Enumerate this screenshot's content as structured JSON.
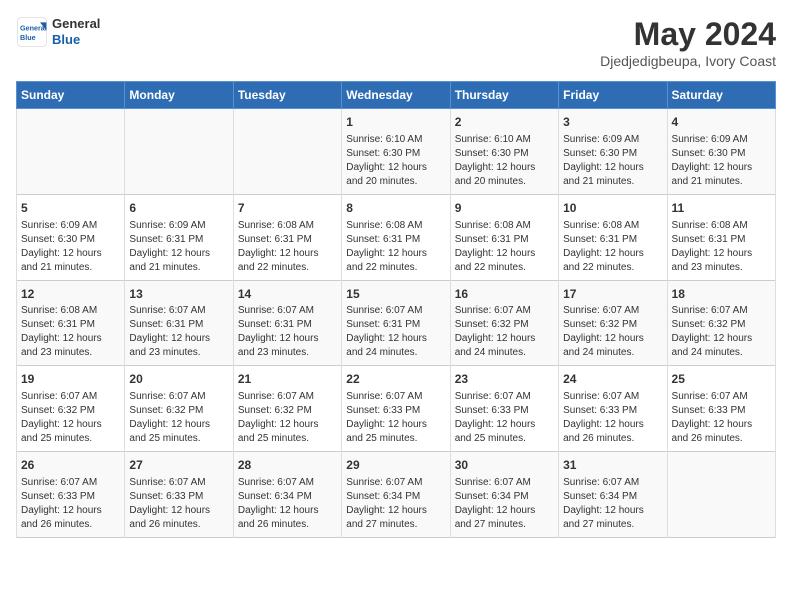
{
  "logo": {
    "line1": "General",
    "line2": "Blue"
  },
  "title": "May 2024",
  "location": "Djedjedigbeupa, Ivory Coast",
  "weekdays": [
    "Sunday",
    "Monday",
    "Tuesday",
    "Wednesday",
    "Thursday",
    "Friday",
    "Saturday"
  ],
  "weeks": [
    [
      {
        "day": "",
        "info": ""
      },
      {
        "day": "",
        "info": ""
      },
      {
        "day": "",
        "info": ""
      },
      {
        "day": "1",
        "info": "Sunrise: 6:10 AM\nSunset: 6:30 PM\nDaylight: 12 hours\nand 20 minutes."
      },
      {
        "day": "2",
        "info": "Sunrise: 6:10 AM\nSunset: 6:30 PM\nDaylight: 12 hours\nand 20 minutes."
      },
      {
        "day": "3",
        "info": "Sunrise: 6:09 AM\nSunset: 6:30 PM\nDaylight: 12 hours\nand 21 minutes."
      },
      {
        "day": "4",
        "info": "Sunrise: 6:09 AM\nSunset: 6:30 PM\nDaylight: 12 hours\nand 21 minutes."
      }
    ],
    [
      {
        "day": "5",
        "info": "Sunrise: 6:09 AM\nSunset: 6:30 PM\nDaylight: 12 hours\nand 21 minutes."
      },
      {
        "day": "6",
        "info": "Sunrise: 6:09 AM\nSunset: 6:31 PM\nDaylight: 12 hours\nand 21 minutes."
      },
      {
        "day": "7",
        "info": "Sunrise: 6:08 AM\nSunset: 6:31 PM\nDaylight: 12 hours\nand 22 minutes."
      },
      {
        "day": "8",
        "info": "Sunrise: 6:08 AM\nSunset: 6:31 PM\nDaylight: 12 hours\nand 22 minutes."
      },
      {
        "day": "9",
        "info": "Sunrise: 6:08 AM\nSunset: 6:31 PM\nDaylight: 12 hours\nand 22 minutes."
      },
      {
        "day": "10",
        "info": "Sunrise: 6:08 AM\nSunset: 6:31 PM\nDaylight: 12 hours\nand 22 minutes."
      },
      {
        "day": "11",
        "info": "Sunrise: 6:08 AM\nSunset: 6:31 PM\nDaylight: 12 hours\nand 23 minutes."
      }
    ],
    [
      {
        "day": "12",
        "info": "Sunrise: 6:08 AM\nSunset: 6:31 PM\nDaylight: 12 hours\nand 23 minutes."
      },
      {
        "day": "13",
        "info": "Sunrise: 6:07 AM\nSunset: 6:31 PM\nDaylight: 12 hours\nand 23 minutes."
      },
      {
        "day": "14",
        "info": "Sunrise: 6:07 AM\nSunset: 6:31 PM\nDaylight: 12 hours\nand 23 minutes."
      },
      {
        "day": "15",
        "info": "Sunrise: 6:07 AM\nSunset: 6:31 PM\nDaylight: 12 hours\nand 24 minutes."
      },
      {
        "day": "16",
        "info": "Sunrise: 6:07 AM\nSunset: 6:32 PM\nDaylight: 12 hours\nand 24 minutes."
      },
      {
        "day": "17",
        "info": "Sunrise: 6:07 AM\nSunset: 6:32 PM\nDaylight: 12 hours\nand 24 minutes."
      },
      {
        "day": "18",
        "info": "Sunrise: 6:07 AM\nSunset: 6:32 PM\nDaylight: 12 hours\nand 24 minutes."
      }
    ],
    [
      {
        "day": "19",
        "info": "Sunrise: 6:07 AM\nSunset: 6:32 PM\nDaylight: 12 hours\nand 25 minutes."
      },
      {
        "day": "20",
        "info": "Sunrise: 6:07 AM\nSunset: 6:32 PM\nDaylight: 12 hours\nand 25 minutes."
      },
      {
        "day": "21",
        "info": "Sunrise: 6:07 AM\nSunset: 6:32 PM\nDaylight: 12 hours\nand 25 minutes."
      },
      {
        "day": "22",
        "info": "Sunrise: 6:07 AM\nSunset: 6:33 PM\nDaylight: 12 hours\nand 25 minutes."
      },
      {
        "day": "23",
        "info": "Sunrise: 6:07 AM\nSunset: 6:33 PM\nDaylight: 12 hours\nand 25 minutes."
      },
      {
        "day": "24",
        "info": "Sunrise: 6:07 AM\nSunset: 6:33 PM\nDaylight: 12 hours\nand 26 minutes."
      },
      {
        "day": "25",
        "info": "Sunrise: 6:07 AM\nSunset: 6:33 PM\nDaylight: 12 hours\nand 26 minutes."
      }
    ],
    [
      {
        "day": "26",
        "info": "Sunrise: 6:07 AM\nSunset: 6:33 PM\nDaylight: 12 hours\nand 26 minutes."
      },
      {
        "day": "27",
        "info": "Sunrise: 6:07 AM\nSunset: 6:33 PM\nDaylight: 12 hours\nand 26 minutes."
      },
      {
        "day": "28",
        "info": "Sunrise: 6:07 AM\nSunset: 6:34 PM\nDaylight: 12 hours\nand 26 minutes."
      },
      {
        "day": "29",
        "info": "Sunrise: 6:07 AM\nSunset: 6:34 PM\nDaylight: 12 hours\nand 27 minutes."
      },
      {
        "day": "30",
        "info": "Sunrise: 6:07 AM\nSunset: 6:34 PM\nDaylight: 12 hours\nand 27 minutes."
      },
      {
        "day": "31",
        "info": "Sunrise: 6:07 AM\nSunset: 6:34 PM\nDaylight: 12 hours\nand 27 minutes."
      },
      {
        "day": "",
        "info": ""
      }
    ]
  ]
}
